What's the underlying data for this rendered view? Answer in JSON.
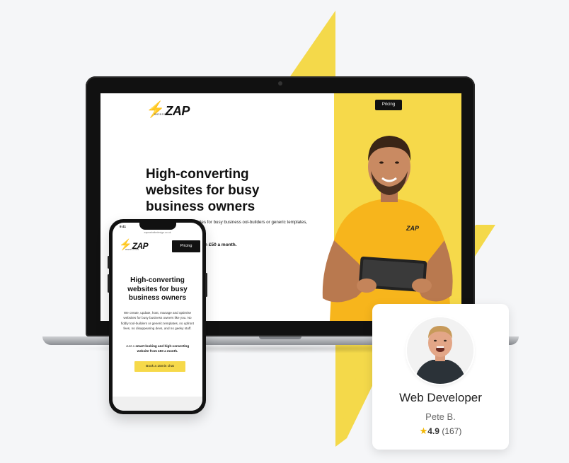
{
  "laptop": {
    "logo_text": "ZAP",
    "logo_sub": "WEBSITES",
    "pricing_label": "Pricing",
    "hero_title": "High-converting websites for busy business owners",
    "hero_body": "manage and optimise websites for busy business ool-builders or generic templates, no upfront fees, no geeky stuff.",
    "hero_offer": "igh-converting website from £50 a month."
  },
  "phone": {
    "time": "9:41",
    "url": "zapwebsitedesign.co.uk",
    "logo_text": "ZAP",
    "logo_sub": "WEBSITES",
    "pricing_label": "Pricing",
    "hero_title": "High-converting websites for busy business owners",
    "hero_body": "We create, update, host, manage and optimise websites for busy business owners like you. No fiddly tool-builders or generic templates, no upfront fees, no disappearing devs, and no geeky stuff.",
    "hero_offer_prefix": "Just a ",
    "hero_offer_bold": "smart-looking and high-converting website from £50 a month.",
    "cta_label": "Book a 15min chat"
  },
  "card": {
    "role": "Web Developer",
    "name": "Pete B.",
    "rating": "4.9",
    "reviews": "(167)"
  },
  "colors": {
    "accent_yellow": "#f6d94a",
    "background": "#f5f6f8",
    "star": "#f2b705"
  },
  "icons": {
    "logo_bolt": "lightning-bolt-icon",
    "rating_star": "star-icon"
  }
}
